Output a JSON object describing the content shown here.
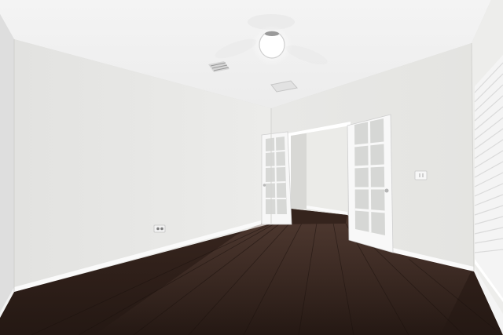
{
  "photo": {
    "subject": "empty-room",
    "colors": {
      "ceiling": "#f3f3f3",
      "left_wall": "#e9e9e7",
      "back_wall": "#e6e6e3",
      "right_wall": "#ececea",
      "floor_dark": "#2a1b16",
      "floor_light": "#4b342b",
      "trim": "#ffffff",
      "door": "#f7f7f7",
      "glass": "#d7d8d6"
    }
  }
}
